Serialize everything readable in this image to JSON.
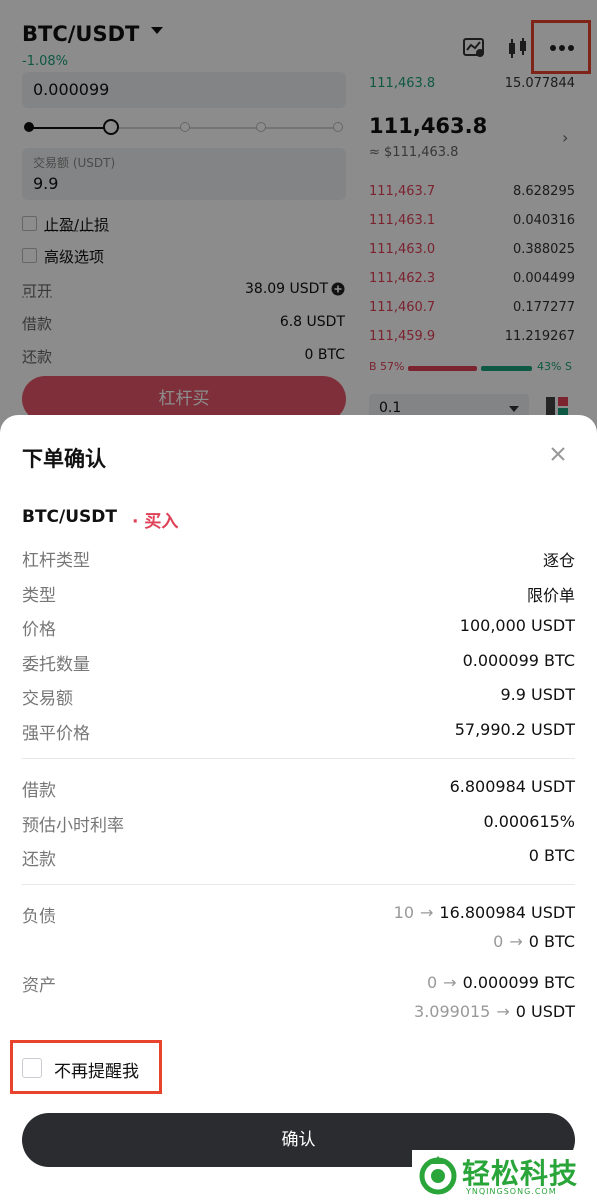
{
  "header": {
    "pair": "BTC/USDT",
    "change": "-1.08%",
    "icons": [
      "chart-settings-icon",
      "candlestick-icon",
      "more-icon"
    ]
  },
  "order_form": {
    "amount_value": "0.000099",
    "slider_percent": 25,
    "total_label": "交易额 (USDT)",
    "total_value": "9.9",
    "tpsl_label": "止盈/止损",
    "advanced_label": "高级选项",
    "available_label": "可开",
    "available_value": "38.09 USDT",
    "borrow_label": "借款",
    "borrow_value": "6.8 USDT",
    "repay_label": "还款",
    "repay_value": "0 BTC",
    "buy_button": "杠杆买"
  },
  "orderbook": {
    "top_row": {
      "price": "111,463.8",
      "qty": "15.077844"
    },
    "last_price": "111,463.8",
    "last_usd": "≈ $111,463.8",
    "asks": [
      {
        "price": "111,463.7",
        "qty": "8.628295"
      },
      {
        "price": "111,463.1",
        "qty": "0.040316"
      },
      {
        "price": "111,463.0",
        "qty": "0.388025"
      },
      {
        "price": "111,462.3",
        "qty": "0.004499"
      },
      {
        "price": "111,460.7",
        "qty": "0.177277"
      },
      {
        "price": "111,459.9",
        "qty": "11.219267"
      }
    ],
    "buy_ratio": "B 57%",
    "sell_ratio": "43% S",
    "buy_ratio_value": 57,
    "depth_select": "0.1"
  },
  "dialog": {
    "title": "下单确认",
    "pair": "BTC/USDT",
    "side": "· 买入",
    "rows1": [
      {
        "label": "杠杆类型",
        "value": "逐仓"
      },
      {
        "label": "类型",
        "value": "限价单"
      },
      {
        "label": "价格",
        "value": "100,000 USDT"
      },
      {
        "label": "委托数量",
        "value": "0.000099 BTC"
      },
      {
        "label": "交易额",
        "value": "9.9 USDT"
      },
      {
        "label": "强平价格",
        "value": "57,990.2 USDT"
      }
    ],
    "rows2": [
      {
        "label": "借款",
        "value": "6.800984 USDT"
      },
      {
        "label": "预估小时利率",
        "value": "0.000615%"
      },
      {
        "label": "还款",
        "value": "0 BTC"
      }
    ],
    "liabilities": {
      "label": "负债",
      "lines": [
        {
          "from": "10",
          "to": "16.800984 USDT"
        },
        {
          "from": "0",
          "to": "0 BTC"
        }
      ]
    },
    "assets": {
      "label": "资产",
      "lines": [
        {
          "from": "0",
          "to": "0.000099 BTC"
        },
        {
          "from": "3.099015",
          "to": "0 USDT"
        }
      ]
    },
    "dont_remind": "不再提醒我",
    "confirm": "确认"
  },
  "watermark": {
    "text": "轻松科技",
    "sub": "YNQINGSONG.COM"
  },
  "colors": {
    "up": "#1ba27a",
    "down": "#e04057",
    "highlight": "#e8432c",
    "confirm_bg": "#2b2c2f"
  }
}
